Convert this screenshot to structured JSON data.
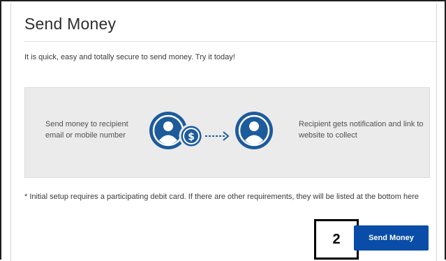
{
  "header": {
    "title": "Send Money"
  },
  "intro": {
    "text": "It is quick, easy and totally secure to send money. Try it today!"
  },
  "flow_panel": {
    "sender_step": "Send money to recipient email or mobile number",
    "recipient_step": "Recipient gets notification and link to website to collect",
    "icons": [
      "sender-person-icon",
      "dollar-coin-icon",
      "dashed-arrow-icon",
      "recipient-person-icon"
    ],
    "coin_symbol": "$",
    "icon_color": "#1d5b9c"
  },
  "footer_note": {
    "text": "* Initial setup requires a participating debit card. If there are other requirements, they will be listed at the bottom here"
  },
  "actions": {
    "send_money_label": "Send Money",
    "accent_color": "#0a4da8"
  },
  "annotation": {
    "step_number": "2"
  }
}
